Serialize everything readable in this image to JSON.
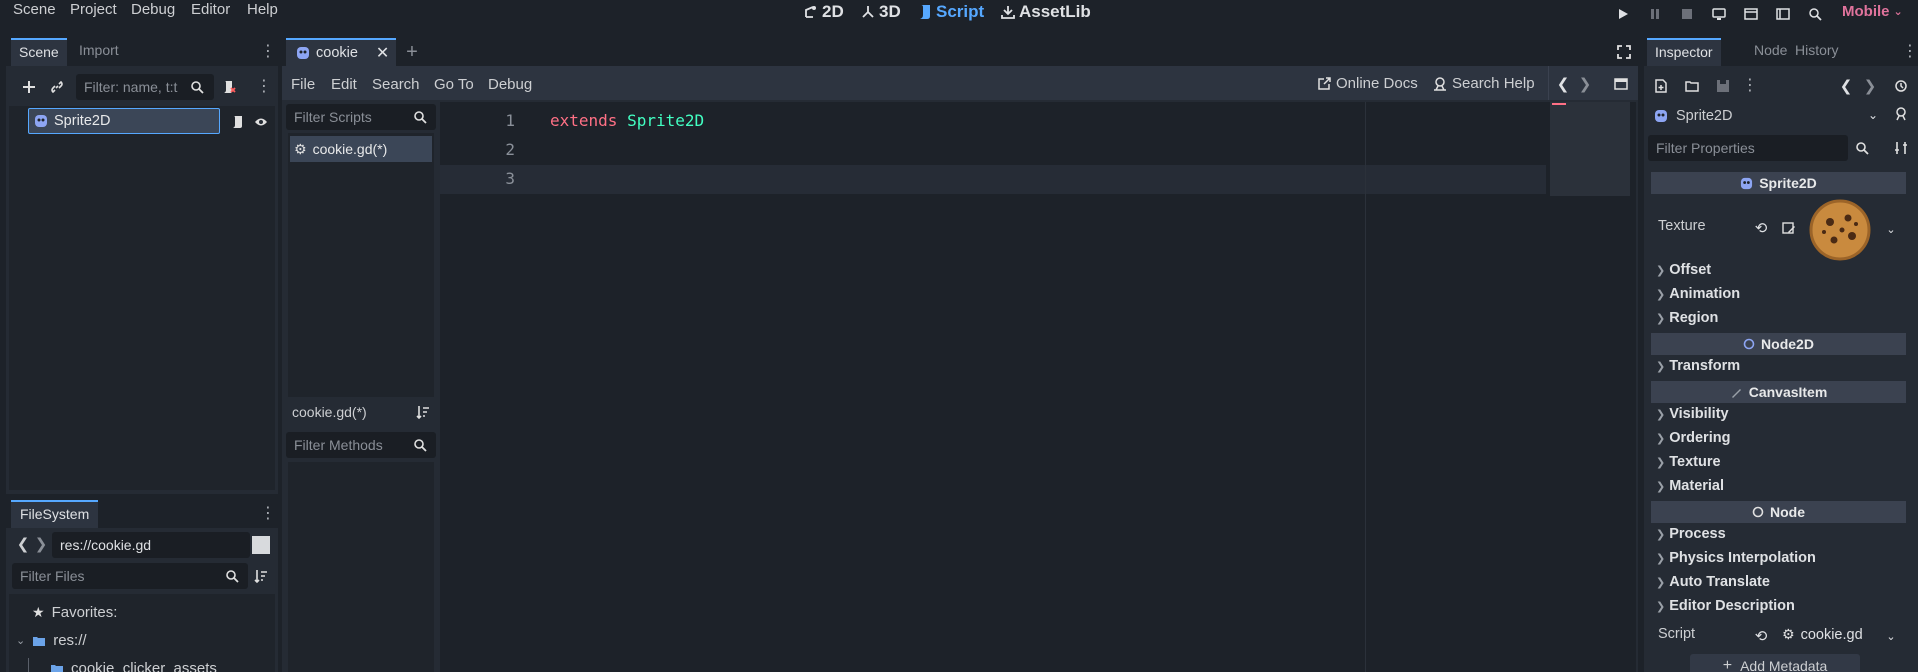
{
  "menu": [
    "Scene",
    "Project",
    "Debug",
    "Editor",
    "Help"
  ],
  "workspaces": [
    {
      "label": "2D",
      "icon": "2d-icon",
      "active": false
    },
    {
      "label": "3D",
      "icon": "3d-icon",
      "active": false
    },
    {
      "label": "Script",
      "icon": "script-icon",
      "active": true
    },
    {
      "label": "AssetLib",
      "icon": "assetlib-icon",
      "active": false
    }
  ],
  "renderer": "Mobile",
  "scene_dock": {
    "tabs": [
      "Scene",
      "Import"
    ],
    "filter_placeholder": "Filter: name, t:t",
    "tree": [
      {
        "label": "Sprite2D",
        "selected": true
      }
    ]
  },
  "filesystem_dock": {
    "tab": "FileSystem",
    "path": "res://cookie.gd",
    "filter_placeholder": "Filter Files",
    "items": [
      {
        "label": "Favorites:",
        "icon": "star-icon"
      },
      {
        "label": "res://",
        "icon": "folder-icon"
      },
      {
        "label": "cookie_clicker_assets",
        "icon": "folder-icon"
      }
    ]
  },
  "editor_tabs": [
    {
      "label": "cookie"
    }
  ],
  "script_menu": [
    "File",
    "Edit",
    "Search",
    "Go To",
    "Debug"
  ],
  "script_toolbar": {
    "online_docs": "Online Docs",
    "search_help": "Search Help"
  },
  "script_list": {
    "filter_placeholder": "Filter Scripts",
    "items": [
      "cookie.gd(*)"
    ],
    "current_script": "cookie.gd(*)",
    "methods_placeholder": "Filter Methods"
  },
  "code": {
    "line_numbers": [
      "1",
      "2",
      "3"
    ],
    "keyword": "extends",
    "class_name": "Sprite2D"
  },
  "inspector": {
    "tabs": [
      "Inspector",
      "Node",
      "History"
    ],
    "node_name": "Sprite2D",
    "filter_placeholder": "Filter Properties",
    "sections": {
      "sprite2d": "Sprite2D",
      "node2d": "Node2D",
      "canvasitem": "CanvasItem",
      "node": "Node"
    },
    "texture_label": "Texture",
    "sprite_groups": [
      "Offset",
      "Animation",
      "Region"
    ],
    "node2d_groups": [
      "Transform"
    ],
    "canvasitem_groups": [
      "Visibility",
      "Ordering",
      "Texture",
      "Material"
    ],
    "node_groups": [
      "Process",
      "Physics Interpolation",
      "Auto Translate",
      "Editor Description"
    ],
    "script_label": "Script",
    "script_value": "cookie.gd",
    "add_metadata": "Add Metadata"
  },
  "colors": {
    "accent": "#56a8ff",
    "keyword": "#ff7085",
    "type": "#42ffc2",
    "mobile": "#e0739c"
  }
}
